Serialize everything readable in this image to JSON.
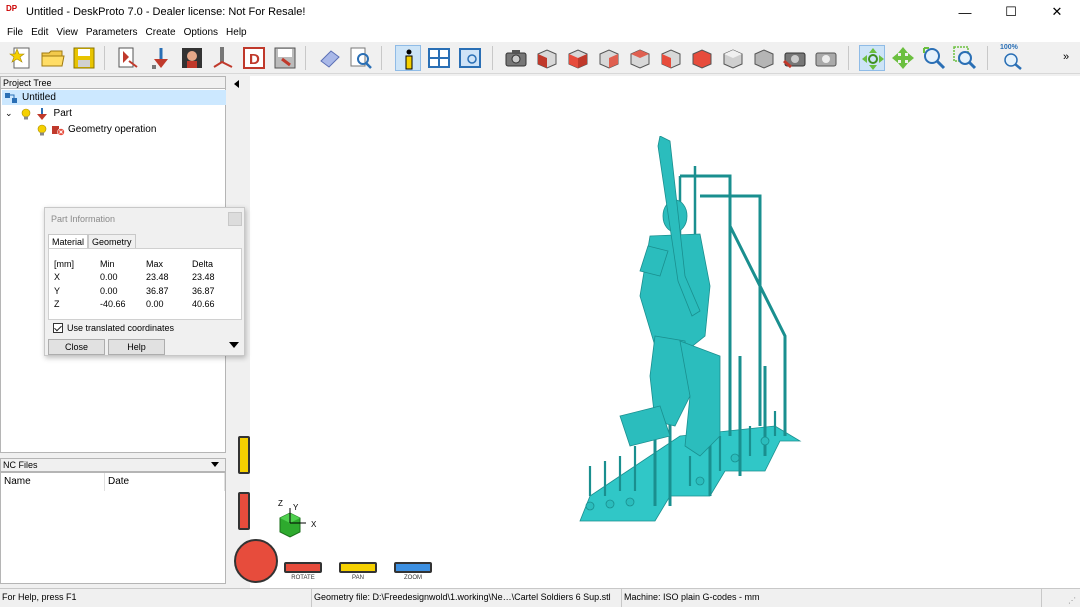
{
  "window": {
    "app_icon_text": "DP",
    "title": "Untitled - DeskProto 7.0 - Dealer license: Not For Resale!",
    "minimize": "—",
    "maximize": "☐",
    "close": "✕"
  },
  "menu": {
    "items": [
      "File",
      "Edit",
      "View",
      "Parameters",
      "Create",
      "Options",
      "Help"
    ]
  },
  "toolbar": {
    "zoom_label": "100%",
    "overflow": "»"
  },
  "project_tree": {
    "header": "Project Tree",
    "root": "Untitled",
    "part": "Part",
    "operation": "Geometry operation"
  },
  "nc_files": {
    "header": "NC Files",
    "col_name": "Name",
    "col_date": "Date"
  },
  "part_info": {
    "title": "Part Information",
    "tab_material": "Material",
    "tab_geometry": "Geometry",
    "headers": [
      "[mm]",
      "Min",
      "Max",
      "Delta"
    ],
    "rows": [
      [
        "X",
        "0.00",
        "23.48",
        "23.48"
      ],
      [
        "Y",
        "0.00",
        "36.87",
        "36.87"
      ],
      [
        "Z",
        "-40.66",
        "0.00",
        "40.66"
      ]
    ],
    "checkbox_label": "Use translated coordinates",
    "close_label": "Close",
    "help_label": "Help"
  },
  "viewport": {
    "axis_z": "Z",
    "axis_y": "Y",
    "axis_x": "X",
    "rotate_label": "ROTATE",
    "pan_label": "PAN",
    "zoom_label": "ZOOM",
    "model_color": "#2bbdbd"
  },
  "status": {
    "help": "For Help, press F1",
    "geometry": "Geometry file: D:\\Freedesignwold\\1.working\\Ne…\\Cartel Soldiers 6 Sup.stl",
    "machine": "Machine: ISO plain G-codes - mm"
  }
}
